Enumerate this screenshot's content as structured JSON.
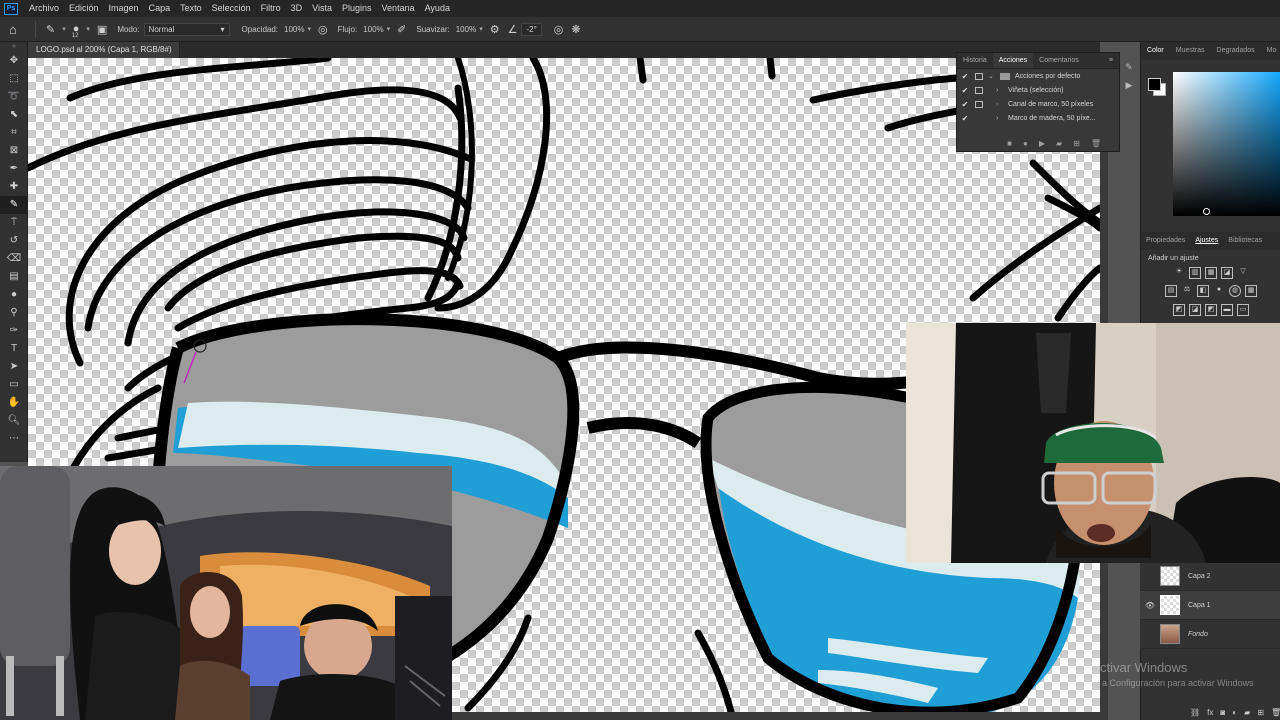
{
  "app": {
    "logo_text": "Ps"
  },
  "menu": [
    "Archivo",
    "Edición",
    "Imagen",
    "Capa",
    "Texto",
    "Selección",
    "Filtro",
    "3D",
    "Vista",
    "Plugins",
    "Ventana",
    "Ayuda"
  ],
  "options": {
    "brush_size": "12",
    "mode_label": "Modo:",
    "mode_value": "Normal",
    "opacity_label": "Opacidad:",
    "opacity_value": "100%",
    "flow_label": "Flujo:",
    "flow_value": "100%",
    "smoothing_label": "Suavizar:",
    "smoothing_value": "100%",
    "angle_value": "-2°"
  },
  "document": {
    "tab_title": "LOGO.psd al 200% (Capa 1, RGB/8#) *",
    "close": "×"
  },
  "actions_panel": {
    "tabs": [
      "Historia",
      "Acciones",
      "Comentarios"
    ],
    "active_tab": "Acciones",
    "rows": [
      {
        "label": "Acciones por defecto"
      },
      {
        "label": "Viñeta (selección)"
      },
      {
        "label": "Canal de marco, 50 píxeles"
      },
      {
        "label": "Marco de madera, 50 píxe..."
      }
    ]
  },
  "color_panel": {
    "tabs": [
      "Color",
      "Muestras",
      "Degradados",
      "Mo"
    ],
    "active_tab": "Color",
    "foreground": "#000000",
    "background": "#ffffff",
    "hue_color": "#12a8ff"
  },
  "properties_panel": {
    "tabs": [
      "Propiedades",
      "Ajustes",
      "Bibliotecas"
    ],
    "active_tab": "Ajustes",
    "adjust_title": "Añadir un ajuste"
  },
  "layers": [
    {
      "name": "Capa 2",
      "visible": false,
      "selected": false
    },
    {
      "name": "Capa 1",
      "visible": true,
      "selected": true
    },
    {
      "name": "Fondo",
      "visible": false,
      "selected": false
    }
  ],
  "watermark": {
    "line1": "ctivar Windows",
    "line2": "a Configuración para activar Windows"
  },
  "colors": {
    "lens_gray": "#9c9c9c",
    "lens_blue": "#1f9fd6",
    "lens_highlight": "#dcecee",
    "outline": "#000000"
  }
}
